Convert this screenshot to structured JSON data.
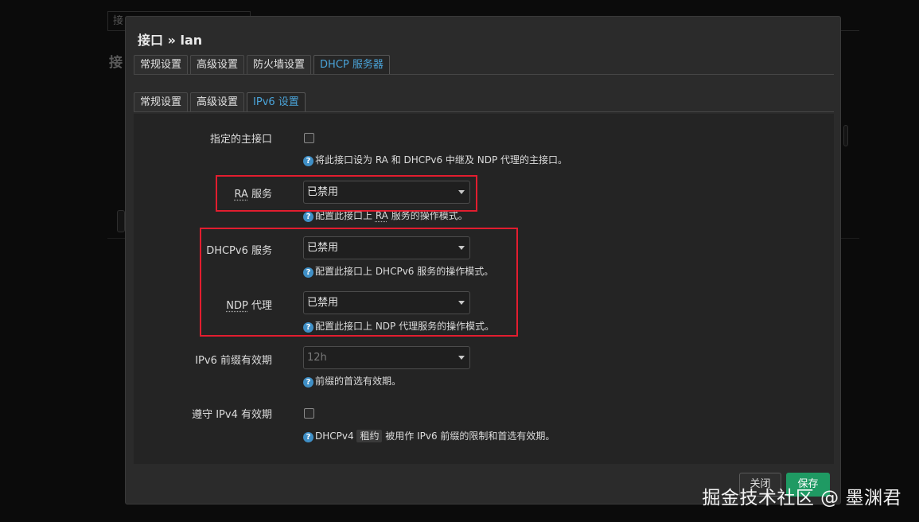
{
  "background": {
    "tab_label": "接",
    "heading": "接"
  },
  "modal": {
    "title": "接口 » lan",
    "main_tabs": [
      "常规设置",
      "高级设置",
      "防火墙设置",
      "DHCP 服务器"
    ],
    "sub_tabs": [
      "常规设置",
      "高级设置",
      "IPv6 设置"
    ],
    "fields": {
      "master": {
        "label": "指定的主接口",
        "checked": false,
        "help": "将此接口设为 RA 和 DHCPv6 中继及 NDP 代理的主接口。"
      },
      "ra": {
        "label_abbr": "RA",
        "label_rest": " 服务",
        "value": "已禁用",
        "help_pre": "配置此接口上 ",
        "help_abbr": "RA",
        "help_post": " 服务的操作模式。"
      },
      "dhcpv6": {
        "label": "DHCPv6 服务",
        "value": "已禁用",
        "help": "配置此接口上 DHCPv6 服务的操作模式。"
      },
      "ndp": {
        "label_abbr": "NDP",
        "label_rest": " 代理",
        "value": "已禁用",
        "help": "配置此接口上 NDP 代理服务的操作模式。"
      },
      "prefix_lifetime": {
        "label": "IPv6 前缀有效期",
        "value": "12h",
        "help": "前缀的首选有效期。"
      },
      "ipv4_lifetime": {
        "label": "遵守 IPv4 有效期",
        "checked": false,
        "help_pre": "DHCPv4 ",
        "help_tag": "租约",
        "help_post": " 被用作 IPv6 前缀的限制和首选有效期。"
      }
    },
    "buttons": {
      "close": "关闭",
      "save": "保存"
    },
    "help_icon": "?"
  },
  "watermark": "掘金技术社区 @ 墨渊君",
  "colors": {
    "accent": "#4aa3d8",
    "save": "#1f9a63",
    "highlight_box": "#e21d2f"
  }
}
